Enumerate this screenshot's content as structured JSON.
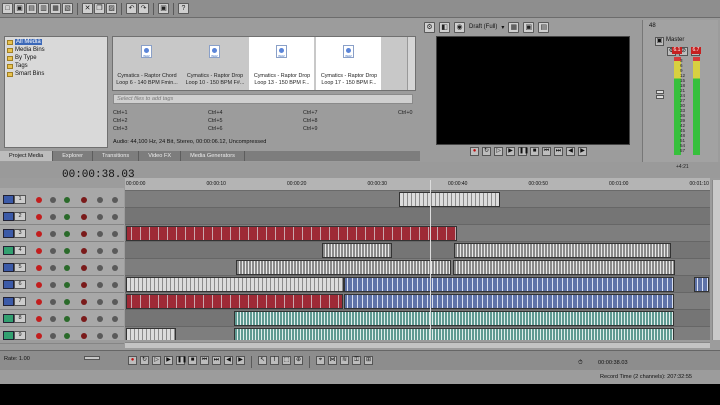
{
  "tree": {
    "items": [
      {
        "label": "All Media",
        "selected": true
      },
      {
        "label": "Media Bins",
        "selected": false
      },
      {
        "label": "By Type",
        "selected": false
      },
      {
        "label": "Tags",
        "selected": false
      },
      {
        "label": "Smart Bins",
        "selected": false
      }
    ]
  },
  "media": {
    "items": [
      {
        "icon": "WAV",
        "caption": "Cymatics - Raptor Chord Loop 6 - 140 BPM Fmin..."
      },
      {
        "icon": "WAV",
        "caption": "Cymatics - Raptor Drop Loop 10 - 150 BPM F#..."
      },
      {
        "icon": "WAV",
        "caption": "Cymatics - Raptor Drop Loop 13 - 150 BPM F..."
      },
      {
        "icon": "WAV",
        "caption": "Cymatics - Raptor Drop Loop 17 - 150 BPM F..."
      }
    ],
    "tag_placeholder": "Select files to add tags",
    "shortcuts": [
      "Ctrl+1",
      "Ctrl+2",
      "Ctrl+3",
      "Ctrl+4",
      "Ctrl+5",
      "Ctrl+6",
      "Ctrl+7",
      "Ctrl+8",
      "Ctrl+9",
      "Ctrl+0"
    ],
    "audio_info": "Audio: 44,100 Hz, 24 Bit, Stereo, 00:00:06.12, Uncompressed"
  },
  "tabs": [
    "Project Media",
    "Explorer",
    "Transitions",
    "Video FX",
    "Media Generators"
  ],
  "preview": {
    "quality": "Draft (Full)"
  },
  "master": {
    "label": "Master",
    "peak_left": "6.1",
    "peak_right": "6.7",
    "field_48": "48",
    "scale": [
      "3",
      "6",
      "9",
      "12",
      "15",
      "18",
      "21",
      "24",
      "27",
      "30",
      "33",
      "36",
      "39",
      "42",
      "45",
      "48",
      "51",
      "54",
      "57"
    ]
  },
  "timeline": {
    "timecode": "00:00:38.03",
    "marker": "+4:21",
    "ruler": [
      "00:00:00",
      "00:00:10",
      "00:00:20",
      "00:00:30",
      "00:00:40",
      "00:00:50",
      "00:01:00",
      "00:01:10"
    ],
    "tracks": [
      "1",
      "2",
      "3",
      "4",
      "5",
      "6",
      "7",
      "8",
      "9"
    ]
  },
  "bottom": {
    "rate": "Rate: 1.00",
    "timecode": "00:00:38.03",
    "record_time": "Record Time (2 channels): 207:32:55"
  }
}
